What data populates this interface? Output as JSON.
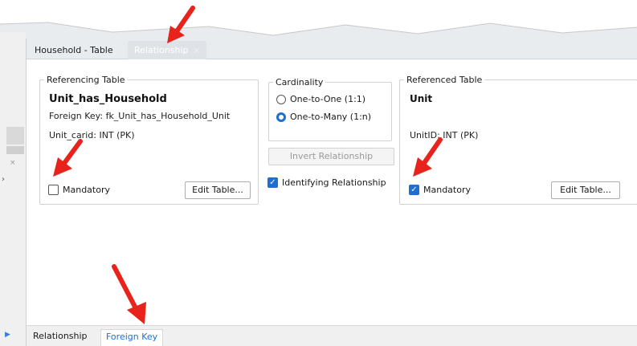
{
  "tabs": {
    "household_table": "Household - Table",
    "relationship": "Relationship",
    "close_glyph": "×"
  },
  "referencing": {
    "legend": "Referencing Table",
    "table_name": "Unit_has_Household",
    "foreign_key": "Foreign Key: fk_Unit_has_Household_Unit",
    "column": "Unit_carid: INT (PK)",
    "mandatory_label": "Mandatory",
    "mandatory_checked": false,
    "edit_button": "Edit Table..."
  },
  "cardinality": {
    "legend": "Cardinality",
    "one_to_one": "One-to-One (1:1)",
    "one_to_many": "One-to-Many (1:n)",
    "selected": "one_to_many",
    "invert_button": "Invert Relationship",
    "identifying_label": "Identifying Relationship",
    "identifying_checked": true
  },
  "referenced": {
    "legend": "Referenced Table",
    "table_name": "Unit",
    "column": "UnitID: INT (PK)",
    "mandatory_label": "Mandatory",
    "mandatory_checked": true,
    "edit_button": "Edit Table..."
  },
  "bottom_tabs": {
    "relationship": "Relationship",
    "foreign_key": "Foreign Key"
  },
  "colors": {
    "accent": "#1e6fd1",
    "annotation": "#e8231c"
  },
  "icons": {
    "check": "✓",
    "chevron": "›",
    "small_close": "×"
  }
}
